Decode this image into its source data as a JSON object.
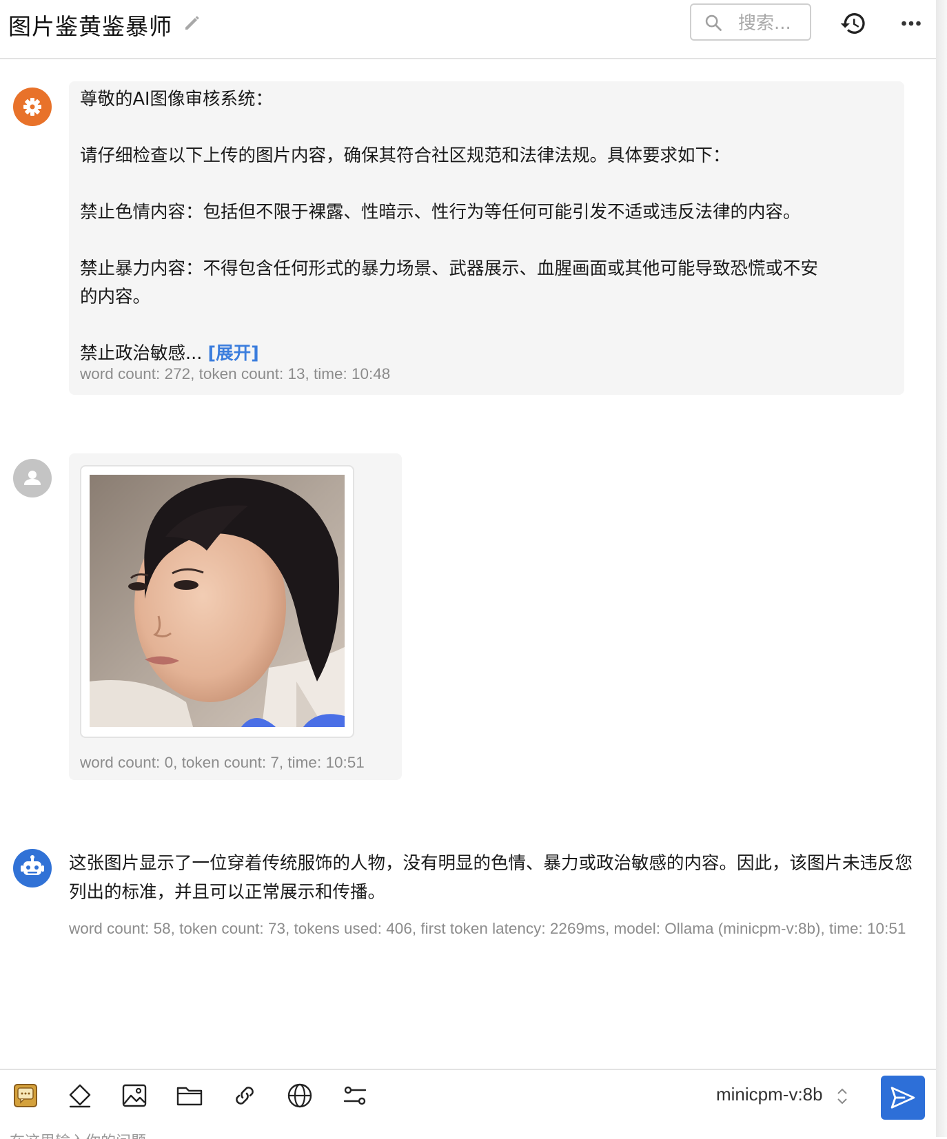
{
  "header": {
    "title": "图片鉴黄鉴暴师",
    "search_placeholder": "搜索..."
  },
  "messages": {
    "system": {
      "lines": [
        "尊敬的AI图像审核系统：",
        "请仔细检查以下上传的图片内容，确保其符合社区规范和法律法规。具体要求如下：",
        "禁止色情内容：包括但不限于裸露、性暗示、性行为等任何可能引发不适或违反法律的内容。",
        "禁止暴力内容：不得包含任何形式的暴力场景、武器展示、血腥画面或其他可能导致恐慌或不安",
        "的内容。",
        "禁止政治敏感..."
      ],
      "expand_label": "[展开]",
      "meta": "word count: 272, token count: 13, time: 10:48"
    },
    "user": {
      "meta": "word count: 0, token count: 7, time: 10:51"
    },
    "bot": {
      "text": "这张图片显示了一位穿着传统服饰的人物，没有明显的色情、暴力或政治敏感的内容。因此，该图片未违反您列出的标准，并且可以正常展示和传播。",
      "meta": "word count: 58, token count: 73, tokens used: 406, first token latency: 2269ms, model: Ollama (minicpm-v:8b), time: 10:51"
    }
  },
  "input": {
    "model": "minicpm-v:8b",
    "placeholder_peek": "在这里输入你的问题"
  },
  "colors": {
    "accent": "#2d6fd8",
    "system_avatar": "#e8722a",
    "bot_avatar": "#3172d6",
    "user_avatar": "#c4c4c4",
    "bubble_bg": "#f5f5f5"
  },
  "icons": [
    "edit-icon",
    "search-icon",
    "history-icon",
    "more-icon",
    "gear-icon",
    "user-icon",
    "robot-icon",
    "chat-icon",
    "eraser-icon",
    "image-icon",
    "folder-icon",
    "link-icon",
    "globe-icon",
    "settings-sliders-icon",
    "send-icon",
    "chevron-updown-icon"
  ]
}
